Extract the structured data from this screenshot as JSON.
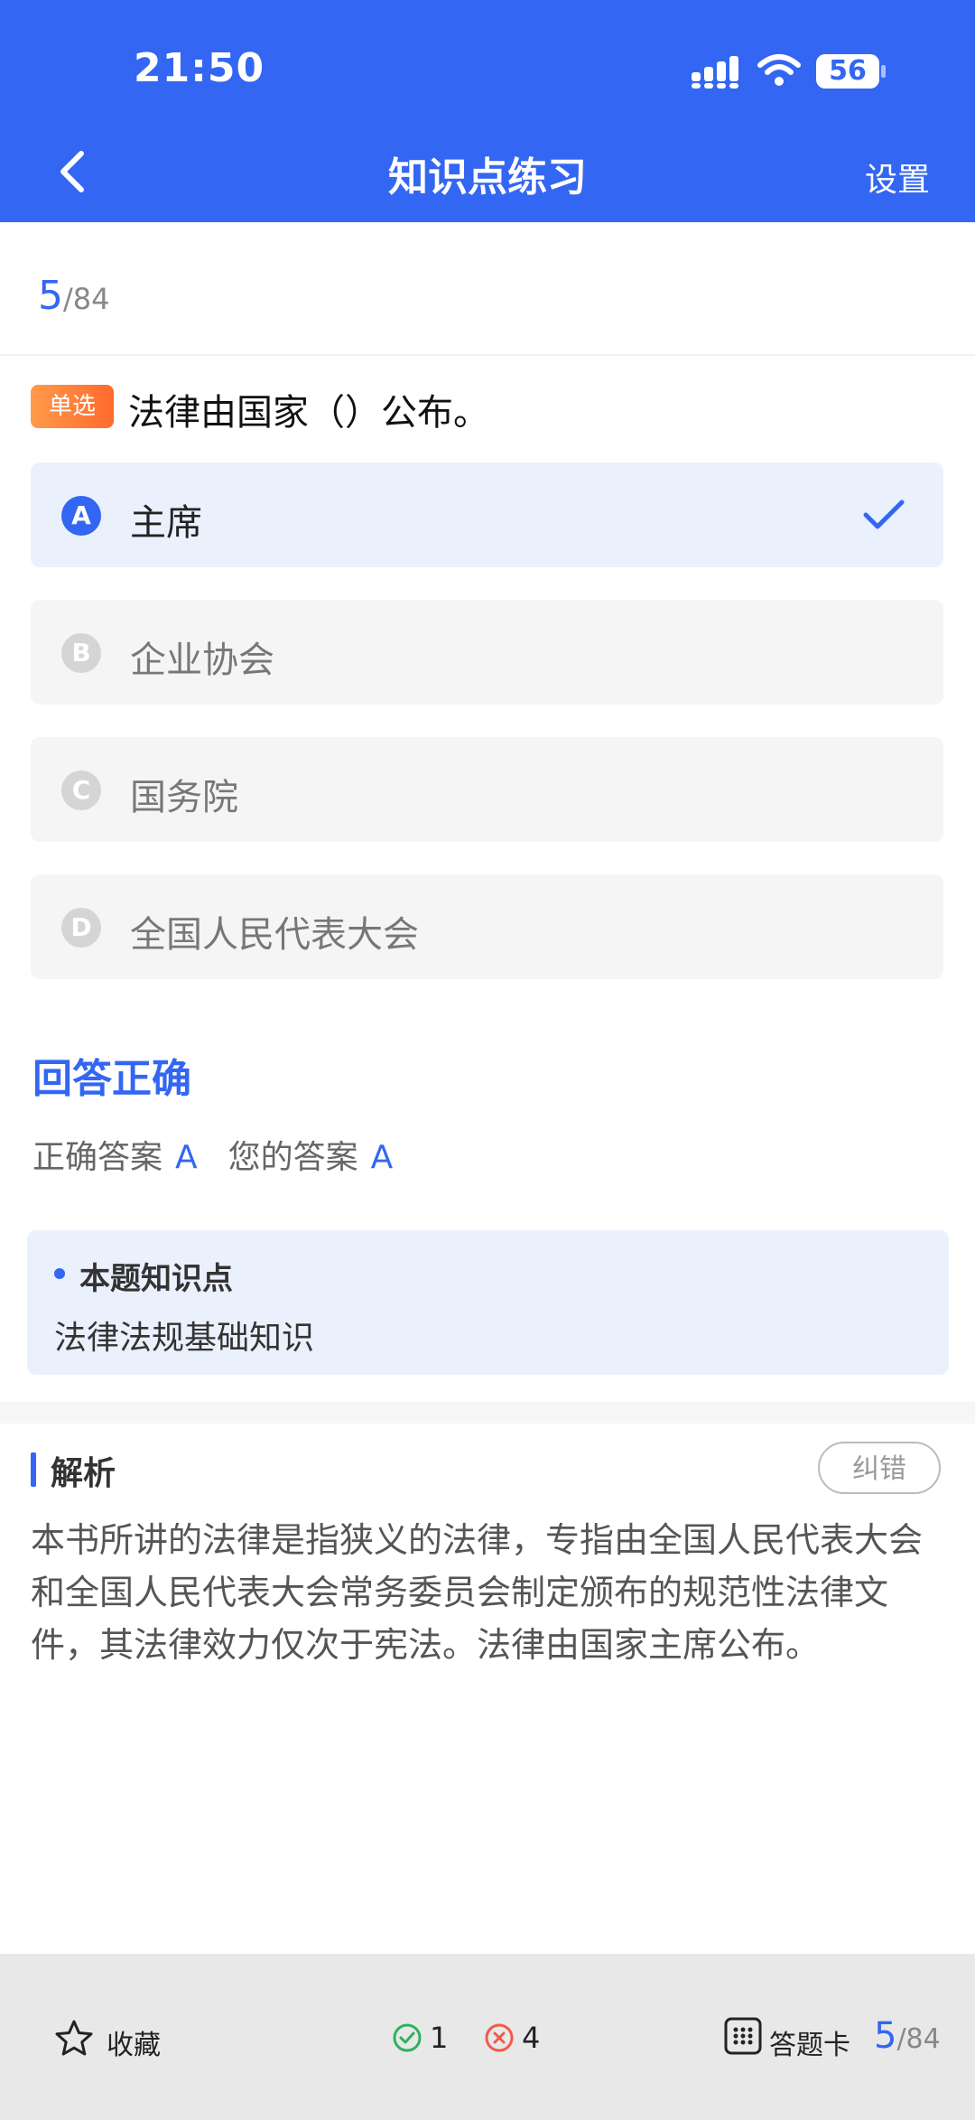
{
  "status": {
    "time": "21:50",
    "battery": "56"
  },
  "header": {
    "title": "知识点练习",
    "settings_label": "设置"
  },
  "progress": {
    "current": "5",
    "total": "/84"
  },
  "question": {
    "type_tag": "单选",
    "text": "法律由国家（）公布。",
    "options": [
      {
        "letter": "A",
        "text": "主席"
      },
      {
        "letter": "B",
        "text": "企业协会"
      },
      {
        "letter": "C",
        "text": "国务院"
      },
      {
        "letter": "D",
        "text": "全国人民代表大会"
      }
    ]
  },
  "result": {
    "title": "回答正确",
    "correct_label": "正确答案",
    "correct_value": "A",
    "yours_label": "您的答案",
    "yours_value": "A"
  },
  "knowledge": {
    "title": "本题知识点",
    "text": "法律法规基础知识"
  },
  "analysis": {
    "title": "解析",
    "report_label": "纠错",
    "text": "本书所讲的法律是指狭义的法律，专指由全国人民代表大会和全国人民代表大会常务委员会制定颁布的规范性法律文件，其法律效力仅次于宪法。法律由国家主席公布。"
  },
  "bottom": {
    "favorite_label": "收藏",
    "correct_count": "1",
    "wrong_count": "4",
    "card_label": "答题卡",
    "progress_current": "5",
    "progress_total": "/84"
  },
  "colors": {
    "accent": "#3366f2",
    "tag": "#ff7a35",
    "correct": "#2fb15d",
    "wrong": "#f05a4a"
  }
}
